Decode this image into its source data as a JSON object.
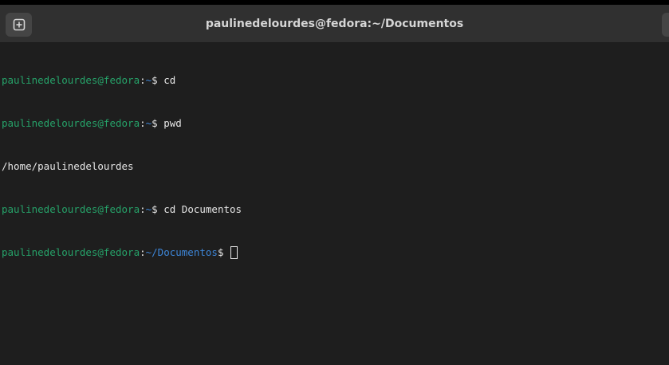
{
  "window": {
    "title": "paulinedelourdes@fedora:~/Documentos"
  },
  "icons": {
    "new_tab": "new-tab-icon"
  },
  "colors": {
    "prompt_user": "#26a269",
    "prompt_path": "#3d86d8",
    "text": "#e6e6e6",
    "background": "#1e1e1e",
    "headerbar": "#303030"
  },
  "terminal": {
    "lines": [
      {
        "user": "paulinedelourdes@fedora",
        "colon": ":",
        "path": "~",
        "symbol": "$ ",
        "command": "cd"
      },
      {
        "user": "paulinedelourdes@fedora",
        "colon": ":",
        "path": "~",
        "symbol": "$ ",
        "command": "pwd"
      },
      {
        "output": "/home/paulinedelourdes"
      },
      {
        "user": "paulinedelourdes@fedora",
        "colon": ":",
        "path": "~",
        "symbol": "$ ",
        "command": "cd Documentos"
      },
      {
        "user": "paulinedelourdes@fedora",
        "colon": ":",
        "path": "~/Documentos",
        "symbol": "$ ",
        "command": ""
      }
    ]
  }
}
